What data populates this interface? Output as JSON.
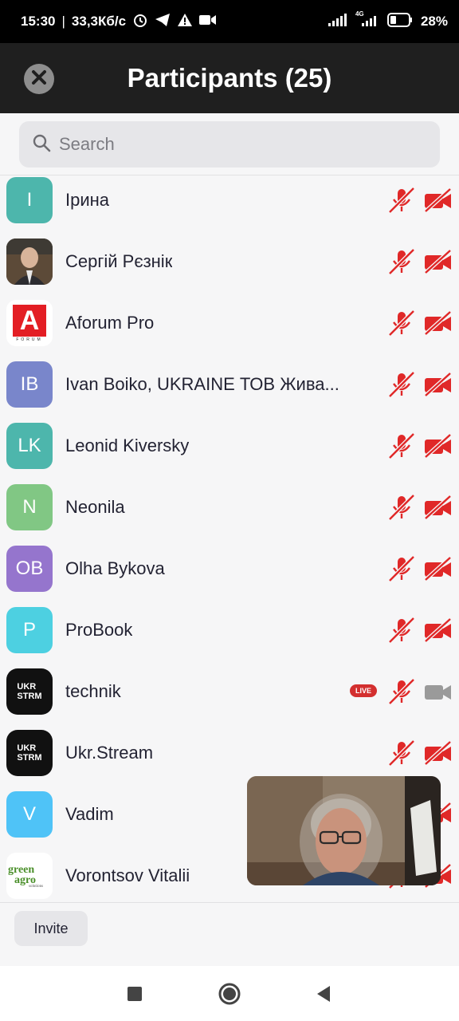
{
  "status_bar": {
    "time": "15:30",
    "speed": "33,3Кб/с",
    "battery": "28%",
    "network": "4G"
  },
  "header": {
    "title": "Participants (25)"
  },
  "search": {
    "placeholder": "Search"
  },
  "participants": [
    {
      "name": "Ірина",
      "initials": "I",
      "color": "#4db6ac",
      "mic": "muted",
      "video": "off"
    },
    {
      "name": "Сергій Рєзнік",
      "initials": "",
      "color": "#5d4a3a",
      "mic": "muted",
      "video": "off"
    },
    {
      "name": "Aforum Pro",
      "initials": "",
      "color": "#ffffff",
      "mic": "muted",
      "video": "off"
    },
    {
      "name": "Ivan Boiko, UKRAINE ТОВ Жива...",
      "initials": "IB",
      "color": "#7986cb",
      "mic": "muted",
      "video": "off"
    },
    {
      "name": "Leonid Kiversky",
      "initials": "LK",
      "color": "#4db6ac",
      "mic": "muted",
      "video": "off"
    },
    {
      "name": "Neonila",
      "initials": "N",
      "color": "#81c784",
      "mic": "muted",
      "video": "off"
    },
    {
      "name": "Olha Bykova",
      "initials": "OB",
      "color": "#9575cd",
      "mic": "muted",
      "video": "off"
    },
    {
      "name": "ProBook",
      "initials": "P",
      "color": "#4dd0e1",
      "mic": "muted",
      "video": "off"
    },
    {
      "name": "technik",
      "initials": "",
      "color": "#111111",
      "mic": "muted",
      "video": "on",
      "badge": "LIVE"
    },
    {
      "name": "Ukr.Stream",
      "initials": "",
      "color": "#111111",
      "mic": "muted",
      "video": "off"
    },
    {
      "name": "Vadim",
      "initials": "V",
      "color": "#4fc3f7",
      "mic": "muted",
      "video": "off"
    },
    {
      "name": "Vorontsov Vitalii",
      "initials": "",
      "color": "#ffffff",
      "mic": "muted",
      "video": "off"
    }
  ],
  "logos": {
    "aforum_letter": "A",
    "aforum_word": "FORUM",
    "ukrstrm_line1": "UKR",
    "ukrstrm_line2": "STRM",
    "greenagro_line1": "green",
    "greenagro_line2": "agro",
    "greenagro_line3": "solutions"
  },
  "footer": {
    "invite_label": "Invite"
  },
  "colors": {
    "muted_red": "#e02828",
    "header_bg": "#1f1f1f",
    "list_bg": "#f6f6f7"
  }
}
